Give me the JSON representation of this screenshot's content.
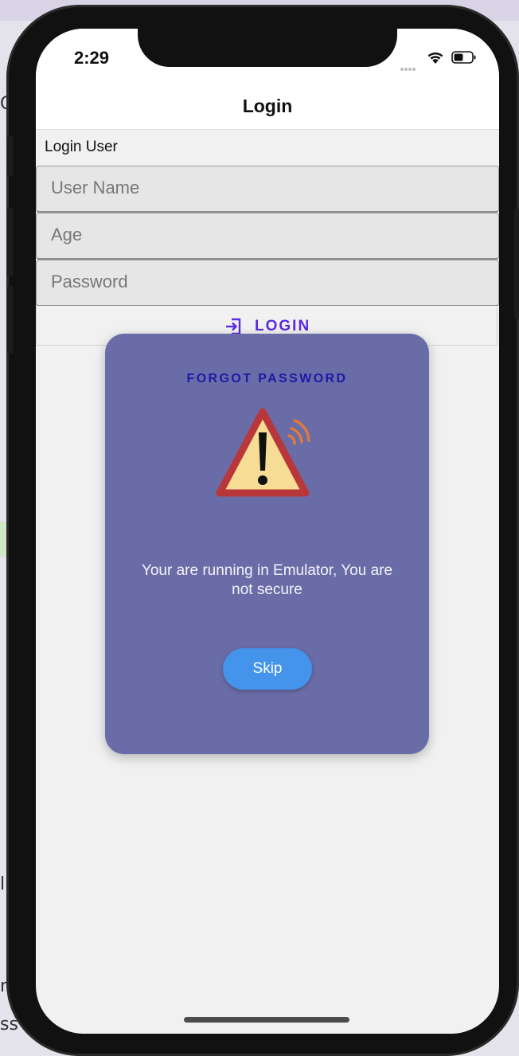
{
  "status_bar": {
    "time": "2:29"
  },
  "nav": {
    "title": "Login"
  },
  "form": {
    "section_label": "Login User",
    "username_placeholder": "User Name",
    "age_placeholder": "Age",
    "password_placeholder": "Password",
    "login_label": "LOGIN"
  },
  "modal": {
    "title": "FORGOT PASSWORD",
    "message": "Your are running in Emulator, You are not secure",
    "skip_label": "Skip"
  },
  "icons": [
    "wifi-icon",
    "battery-icon",
    "login-icon",
    "warning-icon"
  ],
  "colors": {
    "accent": "#5a2be0",
    "modal_bg": "#6a6ca8",
    "modal_title": "#1b1aa8",
    "skip_button": "#4394ea",
    "warning_red": "#b8373a",
    "warning_fill": "#f6dc94",
    "signal_orange": "#e07a3a"
  }
}
